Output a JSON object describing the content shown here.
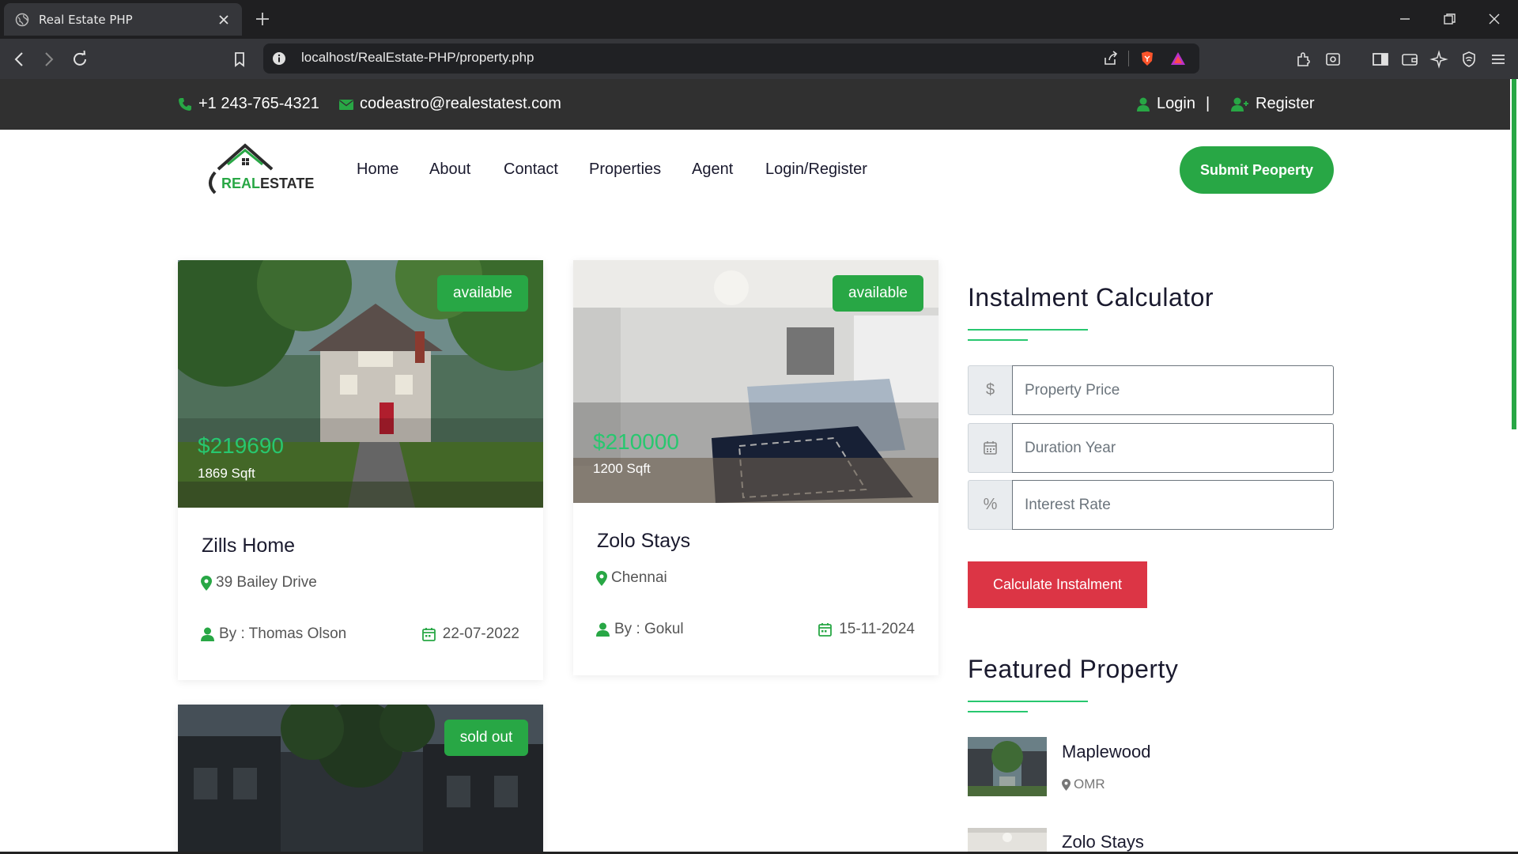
{
  "browser": {
    "tab_title": "Real Estate PHP",
    "url": "localhost/RealEstate-PHP/property.php"
  },
  "topbar": {
    "phone": "+1 243-765-4321",
    "email": "codeastro@realestatest.com",
    "login": "Login",
    "separator": "|",
    "register": "Register"
  },
  "navbar": {
    "logo_text_green": "REAL",
    "logo_text_dark": "ESTATE",
    "items": [
      "Home",
      "About",
      "Contact",
      "Properties",
      "Agent",
      "Login/Register"
    ],
    "submit_label": "Submit Peoperty"
  },
  "properties": [
    {
      "title": "Zills Home",
      "status": "available",
      "price": "$219690",
      "area": "1869 Sqft",
      "location": "39 Bailey Drive",
      "author": "By : Thomas Olson",
      "date": "22-07-2022"
    },
    {
      "title": "Zolo Stays",
      "status": "available",
      "price": "$210000",
      "area": "1200 Sqft",
      "location": "Chennai",
      "author": "By : Gokul",
      "date": "15-11-2024"
    },
    {
      "status": "sold out"
    }
  ],
  "calculator": {
    "heading": "Instalment Calculator",
    "price_addon": "$",
    "price_placeholder": "Property Price",
    "duration_placeholder": "Duration Year",
    "interest_addon": "%",
    "interest_placeholder": "Interest Rate",
    "button": "Calculate Instalment"
  },
  "featured": {
    "heading": "Featured Property",
    "items": [
      {
        "title": "Maplewood",
        "location": "OMR"
      },
      {
        "title": "Zolo Stays"
      }
    ]
  },
  "colors": {
    "accent_green": "#28a745",
    "price_green": "#28c76f",
    "danger_red": "#dc3545",
    "topbar_bg": "#303030"
  },
  "icons": {
    "phone": "phone-icon",
    "email": "envelope-icon",
    "user": "user-icon",
    "user_plus": "user-plus-icon",
    "location": "map-marker-icon",
    "calendar": "calendar-icon"
  }
}
